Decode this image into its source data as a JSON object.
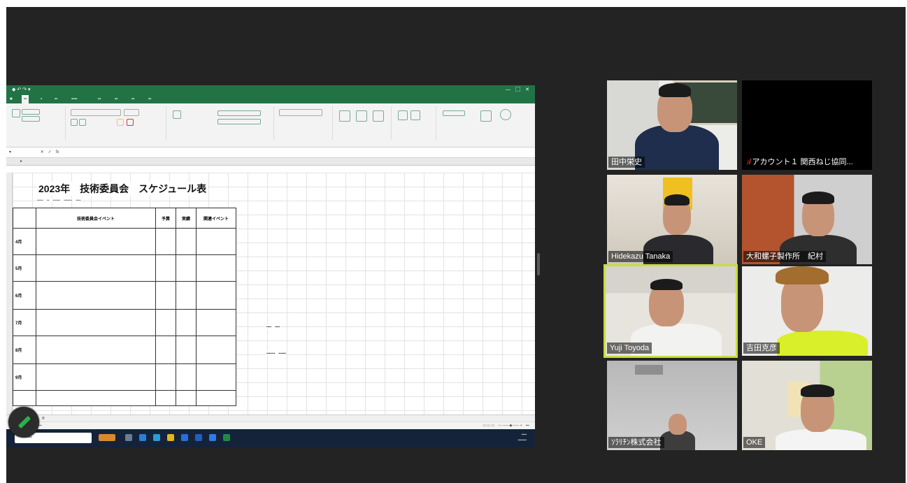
{
  "shared_screen": {
    "sheet_title": "2023年　技術委員会　スケジュール表",
    "table": {
      "headers": [
        "",
        "技術委員会イベント",
        "予算",
        "実績",
        "関連イベント"
      ],
      "rows": [
        {
          "month": "4月",
          "event": "",
          "budget": "",
          "actual": "",
          "related": ""
        },
        {
          "month": "5月",
          "event": "",
          "budget": "",
          "actual": "",
          "related": ""
        },
        {
          "month": "6月",
          "event": "",
          "budget": "",
          "actual": "",
          "related": ""
        },
        {
          "month": "7月",
          "event": "",
          "budget": "",
          "actual": "",
          "related": ""
        },
        {
          "month": "8月",
          "event": "",
          "budget": "",
          "actual": "",
          "related": ""
        },
        {
          "month": "9月",
          "event": "",
          "budget": "",
          "actual": "",
          "related": ""
        },
        {
          "month": "",
          "event": "",
          "budget": "",
          "actual": "",
          "related": ""
        }
      ]
    }
  },
  "participants": [
    {
      "name": "田中栄史",
      "muted": false,
      "active": false,
      "video": true
    },
    {
      "name": "アカウント１ 関西ねじ協同...",
      "muted": true,
      "active": false,
      "video": false
    },
    {
      "name": "Hidekazu Tanaka",
      "muted": false,
      "active": false,
      "video": true
    },
    {
      "name": "大和螺子製作所　紀村",
      "muted": false,
      "active": false,
      "video": true
    },
    {
      "name": "Yuji Toyoda",
      "muted": false,
      "active": true,
      "video": true
    },
    {
      "name": "吉田克彦",
      "muted": false,
      "active": false,
      "video": true
    },
    {
      "name": "ｿﾗﾘﾁﾝ株式会社",
      "muted": false,
      "active": false,
      "video": true
    },
    {
      "name": "OKE",
      "muted": false,
      "active": false,
      "video": true
    }
  ],
  "colors": {
    "excel_green": "#217346",
    "active_speaker_border": "#c8dd3c",
    "background": "#232323",
    "taskbar": "#15233a"
  },
  "icons": [
    "pen-icon",
    "mute-icon",
    "search-icon"
  ]
}
